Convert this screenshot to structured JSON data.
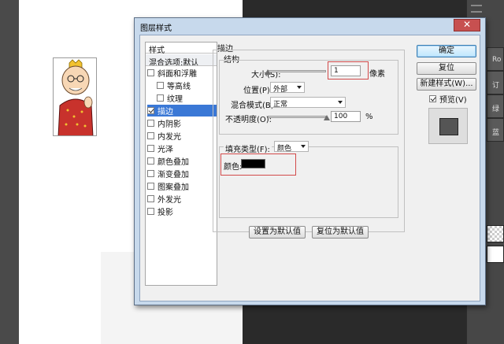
{
  "dialog": {
    "title": "图层样式",
    "close_label": "✕"
  },
  "styles_list": {
    "header": "样式",
    "blend_options": "混合选项:默认",
    "items": [
      {
        "label": "斜面和浮雕",
        "checked": false,
        "indent": false,
        "active": false
      },
      {
        "label": "等高线",
        "checked": false,
        "indent": true,
        "active": false
      },
      {
        "label": "纹理",
        "checked": false,
        "indent": true,
        "active": false
      },
      {
        "label": "描边",
        "checked": true,
        "indent": false,
        "active": true
      },
      {
        "label": "内阴影",
        "checked": false,
        "indent": false,
        "active": false
      },
      {
        "label": "内发光",
        "checked": false,
        "indent": false,
        "active": false
      },
      {
        "label": "光泽",
        "checked": false,
        "indent": false,
        "active": false
      },
      {
        "label": "颜色叠加",
        "checked": false,
        "indent": false,
        "active": false
      },
      {
        "label": "渐变叠加",
        "checked": false,
        "indent": false,
        "active": false
      },
      {
        "label": "图案叠加",
        "checked": false,
        "indent": false,
        "active": false
      },
      {
        "label": "外发光",
        "checked": false,
        "indent": false,
        "active": false
      },
      {
        "label": "投影",
        "checked": false,
        "indent": false,
        "active": false
      }
    ]
  },
  "stroke": {
    "section_title": "描边",
    "structure_title": "结构",
    "size_label": "大小(S):",
    "size_value": "1",
    "size_unit": "像素",
    "position_label": "位置(P):",
    "position_value": "外部",
    "blend_mode_label": "混合模式(B):",
    "blend_mode_value": "正常",
    "opacity_label": "不透明度(O):",
    "opacity_value": "100",
    "opacity_unit": "%",
    "fill_type_label": "填充类型(F):",
    "fill_type_value": "颜色",
    "color_label": "颜色:",
    "color_value": "#000000",
    "set_default_label": "设置为默认值",
    "reset_default_label": "复位为默认值"
  },
  "actions": {
    "ok_label": "确定",
    "reset_label": "复位",
    "new_style_label": "新建样式(W)...",
    "preview_label": "预览(V)",
    "preview_checked": true
  },
  "ps_panel": {
    "tabs": [
      "Ro",
      "订",
      "绿",
      "蓝"
    ]
  }
}
